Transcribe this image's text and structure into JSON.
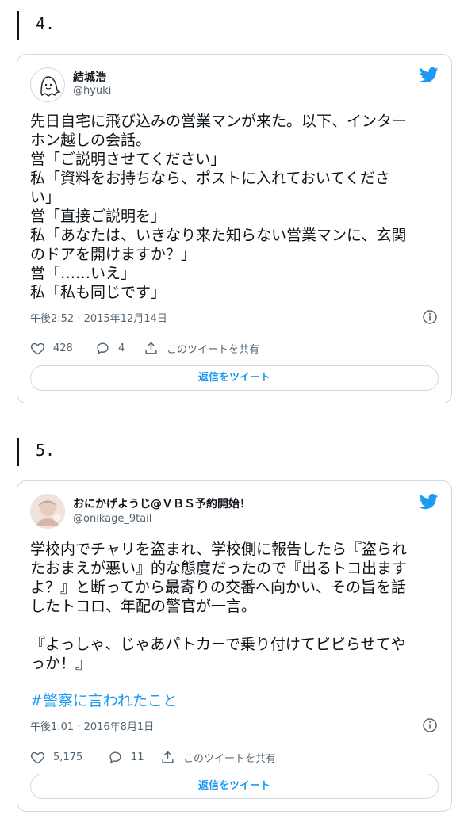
{
  "sections": [
    {
      "number": "4.",
      "tweet": {
        "name": "結城浩",
        "handle": "@hyuki",
        "body": "先日自宅に飛び込みの営業マンが来た。以下、インター\nホン越しの会話。\n営「ご説明させてください」\n私「資料をお持ちなら、ポストに入れておいてくださ\nい」\n営「直接ご説明を」\n私「あなたは、いきなり来た知らない営業マンに、玄関\nのドアを開けますか？」\n営「……いえ」\n私「私も同じです」",
        "timestamp": "午後2:52 · 2015年12月14日",
        "likes": "428",
        "replies": "4",
        "share_label": "このツイートを共有",
        "reply_button": "返信をツイート"
      }
    },
    {
      "number": "5.",
      "tweet": {
        "name": "おにかげようじ@ＶＢＳ予約開始！",
        "handle": "@onikage_9tail",
        "body": "学校内でチャリを盗まれ、学校側に報告したら『盗られ\nたおまえが悪い』的な態度だったので『出るトコ出ます\nよ？』と断ってから最寄りの交番へ向かい、その旨を話\nしたトコロ、年配の警官が一言。\n\n『よっしゃ、じゃあパトカーで乗り付けてビビらせてや\nっか！』",
        "hashtag": "#警察に言われたこと",
        "timestamp": "午後1:01 · 2016年8月1日",
        "likes": "5,175",
        "replies": "11",
        "share_label": "このツイートを共有",
        "reply_button": "返信をツイート"
      }
    }
  ],
  "colors": {
    "accent": "#1d9bf0",
    "secondary_text": "#536471",
    "border": "#cfd9de"
  },
  "icons": [
    "ghost-avatar",
    "photo-avatar",
    "twitter-bird-icon",
    "info-icon",
    "heart-icon",
    "reply-icon",
    "share-icon"
  ]
}
